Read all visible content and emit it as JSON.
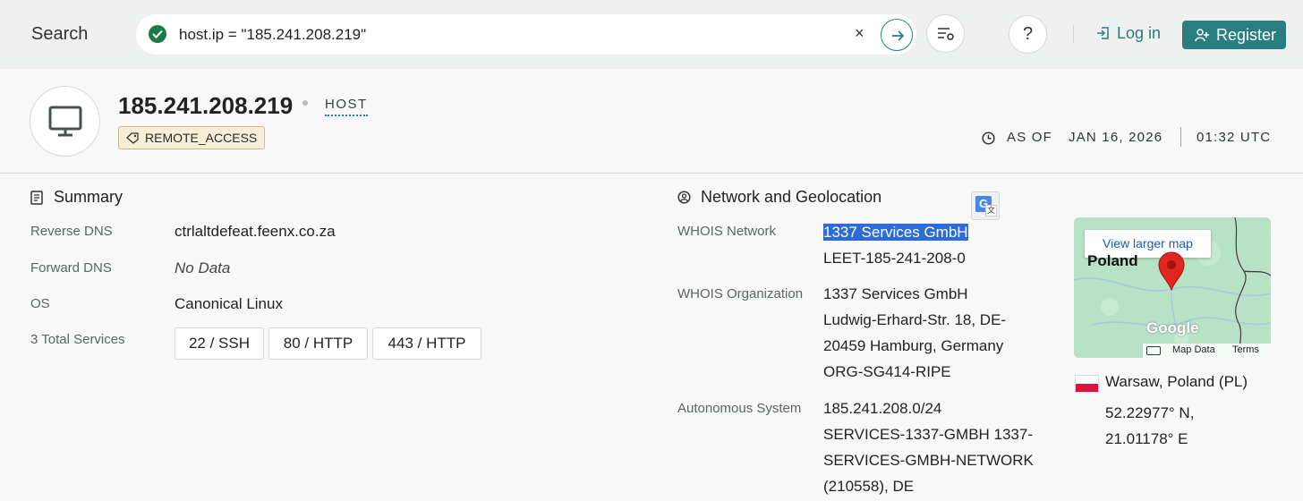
{
  "header": {
    "search_label": "Search",
    "query": "host.ip = \"185.241.208.219\"",
    "clear_symbol": "×",
    "help_symbol": "?",
    "login": "Log in",
    "register": "Register"
  },
  "host": {
    "ip": "185.241.208.219",
    "type": "HOST",
    "tag": "REMOTE_ACCESS",
    "as_of_label": "AS OF",
    "date": "JAN 16, 2026",
    "time": "01:32 UTC"
  },
  "summary": {
    "title": "Summary",
    "rows": [
      {
        "label": "Reverse DNS",
        "value": "ctrlaltdefeat.feenx.co.za"
      },
      {
        "label": "Forward DNS",
        "value": "No Data"
      },
      {
        "label": "OS",
        "value": "Canonical Linux"
      },
      {
        "label": "3 Total Services"
      }
    ],
    "services": [
      "22 / SSH",
      "80 / HTTP",
      "443 / HTTP"
    ]
  },
  "network": {
    "title": "Network and Geolocation",
    "whois_network_label": "WHOIS Network",
    "whois_network": [
      "1337 Services GmbH",
      "LEET-185-241-208-0"
    ],
    "whois_org_label": "WHOIS Organization",
    "whois_org": [
      "1337 Services GmbH",
      "Ludwig-Erhard-Str. 18, DE-",
      "20459 Hamburg, Germany",
      "ORG-SG414-RIPE"
    ],
    "asn_label": "Autonomous System",
    "asn": [
      "185.241.208.0/24",
      "SERVICES-1337-GMBH 1337-",
      "SERVICES-GMBH-NETWORK",
      "(210558), DE"
    ]
  },
  "map": {
    "view_larger": "View larger map",
    "country_label": "Poland",
    "google": "Google",
    "map_data": "Map Data",
    "terms": "Terms"
  },
  "location": {
    "city": "Warsaw, Poland (PL)",
    "lat": "52.22977° N,",
    "lon": "21.01178° E"
  },
  "colors": {
    "accent": "#2a7e80",
    "tag_bg": "#f6eed6",
    "highlight": "#2e6bd8",
    "check": "#1e7a46"
  }
}
